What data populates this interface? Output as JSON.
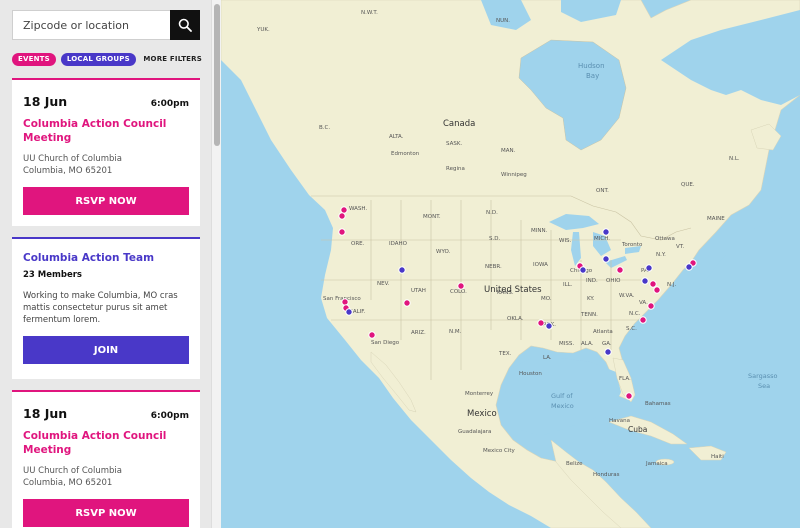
{
  "search": {
    "placeholder": "Zipcode or location"
  },
  "filters": {
    "events_label": "EVENTS",
    "groups_label": "LOCAL GROUPS",
    "more_label": "MORE FILTERS"
  },
  "cards": {
    "event1": {
      "date": "18 Jun",
      "time": "6:00pm",
      "title": "Columbia Action Council Meeting",
      "addr1": "UU Church of Columbia",
      "addr2": "Columbia, MO 65201",
      "button": "RSVP NOW"
    },
    "group1": {
      "title": "Columbia Action Team",
      "members": "23 Members",
      "description": "Working to make Columbia, MO cras mattis consectetur purus sit amet fermentum lorem.",
      "button": "JOIN"
    },
    "event2": {
      "date": "18 Jun",
      "time": "6:00pm",
      "title": "Columbia Action Council Meeting",
      "addr1": "UU Church of Columbia",
      "addr2": "Columbia, MO 65201",
      "button": "RSVP NOW"
    }
  },
  "colors": {
    "event": "#e0157e",
    "group": "#4938c8",
    "water": "#9fd3ec",
    "land": "#f3f1d8"
  },
  "map": {
    "labels": {
      "nwt": "N.W.T.",
      "yuk": "YUK.",
      "nun": "NUN.",
      "hudson1": "Hudson",
      "hudson2": "Bay",
      "canada": "Canada",
      "bc": "B.C.",
      "alta": "ALTA.",
      "sask": "SASK.",
      "man": "MAN.",
      "ont": "ONT.",
      "que": "QUE.",
      "edmonton": "Edmonton",
      "nl": "N.L.",
      "wash": "WASH.",
      "ore": "ORE.",
      "idaho": "IDAHO",
      "mont": "MONT.",
      "wyo": "WYO.",
      "nd": "N.D.",
      "sd": "S.D.",
      "nebr": "NEBR.",
      "kans": "KANS.",
      "colo": "COLO.",
      "utah": "UTAH",
      "nev": "NEV.",
      "calif": "CALIF.",
      "ariz": "ARIZ.",
      "nm": "N.M.",
      "tex": "TEX.",
      "okla": "OKLA.",
      "iowa": "IOWA",
      "minn": "MINN.",
      "wis": "WIS.",
      "ill": "ILL.",
      "mo": "MO.",
      "ark": "ARK.",
      "la": "LA.",
      "miss": "MISS.",
      "ala": "ALA.",
      "ga": "GA.",
      "sc": "S.C.",
      "nc": "N.C.",
      "tenn": "TENN.",
      "ky": "KY.",
      "ohio": "OHIO",
      "ind": "IND.",
      "mich": "MICH.",
      "pa": "PA.",
      "ny": "N.Y.",
      "wva": "W.VA.",
      "va": "VA.",
      "nj": "N.J.",
      "vt": "VT.",
      "maine": "MAINE",
      "fla": "FLA.",
      "usa": "United States",
      "mexico": "Mexico",
      "cuba": "Cuba",
      "bahamas": "Bahamas",
      "gulf1": "Gulf of",
      "gulf2": "Mexico",
      "sargasso1": "Sargasso",
      "sargasso2": "Sea",
      "sf": "San Francisco",
      "sandiego": "San Diego",
      "chicago": "Chicago",
      "toronto": "Toronto",
      "ottawa": "Ottawa",
      "atlanta": "Atlanta",
      "houston": "Houston",
      "monterrey": "Monterrey",
      "guadalajara": "Guadalajara",
      "mexicocity": "Mexico City",
      "havana": "Havana",
      "belize": "Belize",
      "honduras": "Honduras",
      "jamaica": "Jamaica",
      "haiti": "Haiti",
      "regina": "Regina",
      "winnipeg": "Winnipeg"
    }
  }
}
